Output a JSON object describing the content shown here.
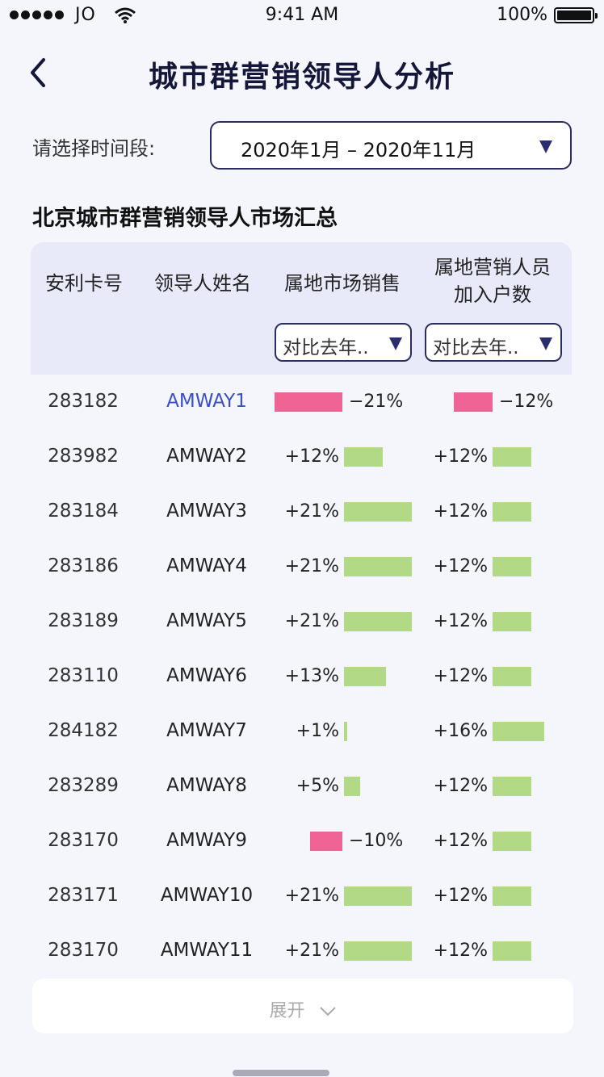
{
  "status_bar": {
    "carrier": "JO",
    "time": "9:41 AM",
    "battery": "100%"
  },
  "header": {
    "title": "城市群营销领导人分析"
  },
  "filter": {
    "label": "请选择时间段:",
    "value": "2020年1月 – 2020年11月"
  },
  "section_title": "北京城市群营销领导人市场汇总",
  "table": {
    "headers": {
      "card": "安利卡号",
      "name": "领导人姓名",
      "sales": "属地市场销售",
      "members_line1": "属地营销人员",
      "members_line2": "加入户数"
    },
    "sales_compare": "对比去年..",
    "members_compare": "对比去年..",
    "rows": [
      {
        "card": "283182",
        "name": "AMWAY1",
        "sales": "−21%",
        "sales_value": -21,
        "members": "−12%",
        "members_value": -12
      },
      {
        "card": "283982",
        "name": "AMWAY2",
        "sales": "+12%",
        "sales_value": 12,
        "members": "+12%",
        "members_value": 12
      },
      {
        "card": "283184",
        "name": "AMWAY3",
        "sales": "+21%",
        "sales_value": 21,
        "members": "+12%",
        "members_value": 12
      },
      {
        "card": "283186",
        "name": "AMWAY4",
        "sales": "+21%",
        "sales_value": 21,
        "members": "+12%",
        "members_value": 12
      },
      {
        "card": "283189",
        "name": "AMWAY5",
        "sales": "+21%",
        "sales_value": 21,
        "members": "+12%",
        "members_value": 12
      },
      {
        "card": "283110",
        "name": "AMWAY6",
        "sales": "+13%",
        "sales_value": 13,
        "members": "+12%",
        "members_value": 12
      },
      {
        "card": "284182",
        "name": "AMWAY7",
        "sales": "+1%",
        "sales_value": 1,
        "members": "+16%",
        "members_value": 16
      },
      {
        "card": "283289",
        "name": "AMWAY8",
        "sales": "+5%",
        "sales_value": 5,
        "members": "+12%",
        "members_value": 12
      },
      {
        "card": "283170",
        "name": "AMWAY9",
        "sales": "−10%",
        "sales_value": -10,
        "members": "+12%",
        "members_value": 12
      },
      {
        "card": "283171",
        "name": "AMWAY10",
        "sales": "+21%",
        "sales_value": 21,
        "members": "+12%",
        "members_value": 12
      },
      {
        "card": "283170",
        "name": "AMWAY11",
        "sales": "+21%",
        "sales_value": 21,
        "members": "+12%",
        "members_value": 12
      }
    ]
  },
  "expand": {
    "label": "展开"
  },
  "colors": {
    "positive": "#b2d986",
    "negative": "#f06395",
    "link": "#3b4fc9",
    "accent": "#2a2d5e"
  },
  "icons": {
    "back": "chevron-left-icon",
    "dropdown": "triangle-down-icon",
    "expand": "chevron-down-icon"
  }
}
